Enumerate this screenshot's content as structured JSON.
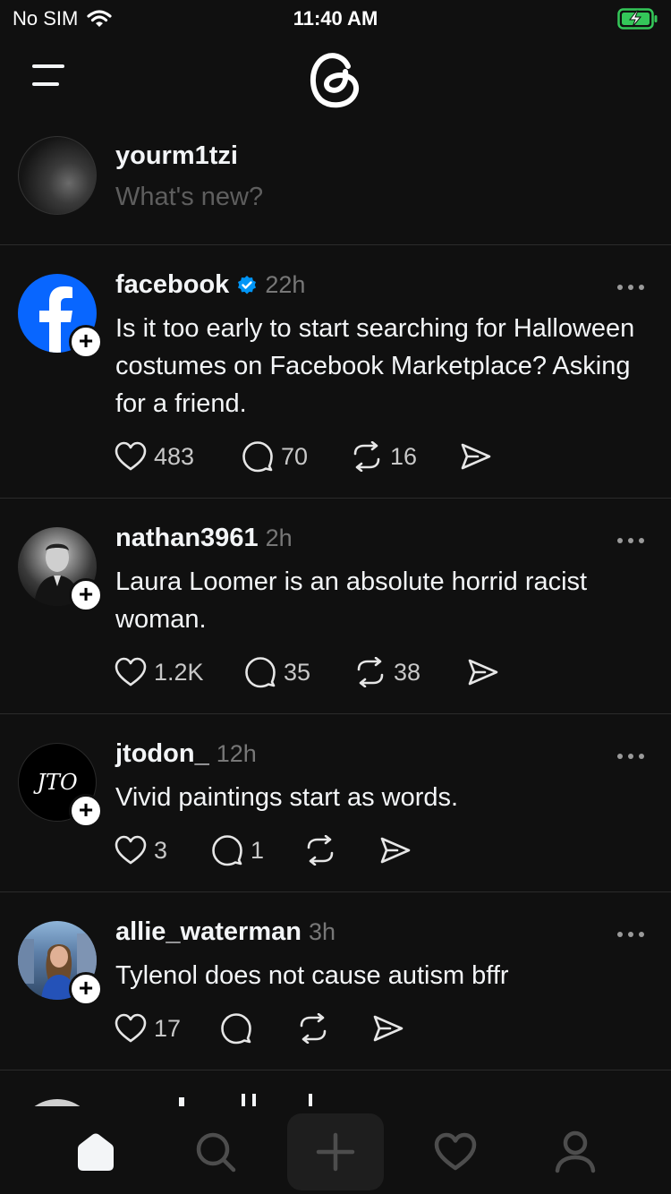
{
  "status": {
    "carrier": "No SIM",
    "time": "11:40 AM"
  },
  "composer": {
    "username": "yourm1tzi",
    "placeholder": "What's new?"
  },
  "posts": [
    {
      "username": "facebook",
      "verified": true,
      "time": "22h",
      "text": "Is it too early to start searching for Halloween costumes on Facebook Marketplace? Asking for a friend.",
      "likes": "483",
      "replies": "70",
      "reposts": "16",
      "avatar": "facebook-logo"
    },
    {
      "username": "nathan3961",
      "verified": false,
      "time": "2h",
      "text": "Laura Loomer is an absolute horrid racist woman.",
      "likes": "1.2K",
      "replies": "35",
      "reposts": "38",
      "avatar": "portrait-photo"
    },
    {
      "username": "jtodon_",
      "verified": false,
      "time": "12h",
      "text": "Vivid paintings start as words.",
      "likes": "3",
      "replies": "1",
      "reposts": "",
      "avatar": "monogram",
      "avatar_text": "JTO"
    },
    {
      "username": "allie_waterman",
      "verified": false,
      "time": "3h",
      "text": "Tylenol does not cause autism bffr",
      "likes": "17",
      "replies": "",
      "reposts": "",
      "avatar": "selfie-photo"
    }
  ],
  "colors": {
    "background": "#101010",
    "verified": "#0095f6",
    "facebook": "#0866ff",
    "battery": "#34c759"
  },
  "icons": [
    "wifi-icon",
    "battery-charging-icon",
    "menu-icon",
    "threads-logo",
    "heart-icon",
    "comment-icon",
    "repost-icon",
    "share-icon",
    "home-icon",
    "search-icon",
    "plus-icon",
    "activity-heart-icon",
    "profile-icon"
  ]
}
